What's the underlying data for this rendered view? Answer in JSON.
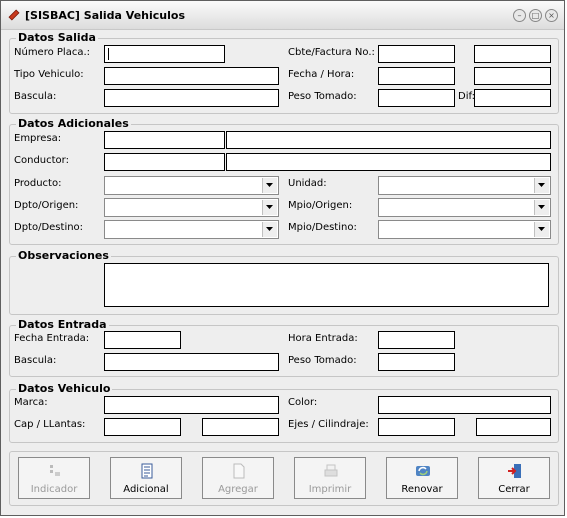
{
  "window": {
    "title": "[SISBAC] Salida Vehiculos"
  },
  "datos_salida": {
    "legend": "Datos Salida",
    "numero_placa_label": "Número Placa.:",
    "tipo_vehiculo_label": "Tipo Vehiculo:",
    "bascula_label": "Bascula:",
    "cbte_factura_label": "Cbte/Factura No.:",
    "fecha_hora_label": "Fecha / Hora:",
    "peso_tomado_label": "Peso Tomado:",
    "dif_label": "Dif:"
  },
  "datos_adicionales": {
    "legend": "Datos Adicionales",
    "empresa_label": "Empresa:",
    "conductor_label": "Conductor:",
    "producto_label": "Producto:",
    "dpto_origen_label": "Dpto/Origen:",
    "dpto_destino_label": "Dpto/Destino:",
    "unidad_label": "Unidad:",
    "mpio_origen_label": "Mpio/Origen:",
    "mpio_destino_label": "Mpio/Destino:"
  },
  "observaciones": {
    "legend": "Observaciones"
  },
  "datos_entrada": {
    "legend": "Datos Entrada",
    "fecha_entrada_label": "Fecha Entrada:",
    "bascula_label": "Bascula:",
    "hora_entrada_label": "Hora Entrada:",
    "peso_tomado_label": "Peso Tomado:"
  },
  "datos_vehiculo": {
    "legend": "Datos Vehiculo",
    "marca_label": "Marca:",
    "cap_llantas_label": "Cap / LLantas:",
    "color_label": "Color:",
    "ejes_cilindraje_label": "Ejes / Cilindraje:"
  },
  "buttons": {
    "indicador": "Indicador",
    "adicional": "Adicional",
    "agregar": "Agregar",
    "imprimir": "Imprimir",
    "renovar": "Renovar",
    "cerrar": "Cerrar"
  },
  "icons": {
    "title": "pencil-icon",
    "indicador": "indicator-icon",
    "adicional": "document-list-icon",
    "agregar": "new-page-icon",
    "imprimir": "printer-icon",
    "renovar": "refresh-icon",
    "cerrar": "exit-door-icon"
  }
}
